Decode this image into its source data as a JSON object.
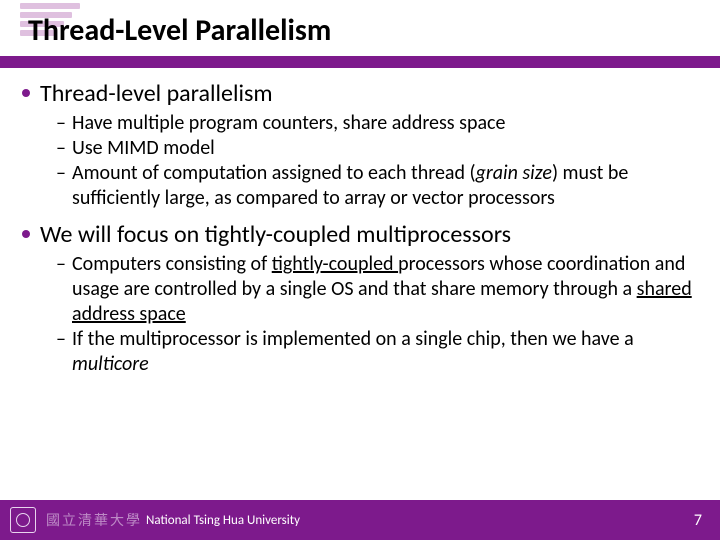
{
  "title": "Thread-Level Parallelism",
  "bullets": {
    "b1": {
      "label": "Thread-level parallelism",
      "subs": {
        "s1": "Have multiple program counters, share address space",
        "s2": "Use MIMD model",
        "s3a": "Amount of computation assigned to each thread (",
        "s3b": "grain size",
        "s3c": ") must be sufficiently large, as compared to array or vector processors"
      }
    },
    "b2": {
      "label": "We will focus on tightly-coupled multiprocessors",
      "subs": {
        "s1a": "Computers consisting of ",
        "s1b": "tightly-coupled ",
        "s1c": "processors whose coordination and usage are controlled by a single OS and that share memory through a ",
        "s1d": "shared address space",
        "s2a": "If the multiprocessor is implemented on a single chip, then we have a ",
        "s2b": "multicore"
      }
    }
  },
  "footer": {
    "university": "National Tsing Hua University",
    "page": "7"
  }
}
